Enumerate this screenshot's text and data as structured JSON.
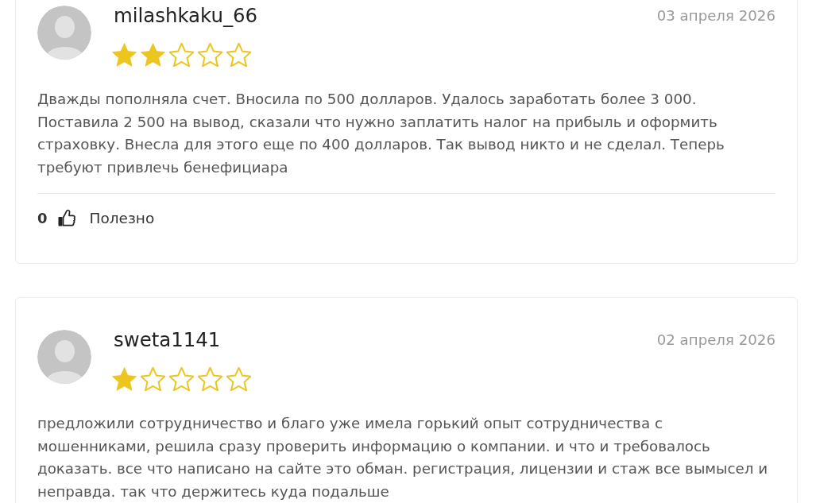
{
  "reviews": [
    {
      "username": "milashkaku_66",
      "date": "03 апреля 2026",
      "stars": 2,
      "text": "Дважды пополняла счет. Вносила по 500 долларов. Удалось заработать более 3 000. Поставила 2 500 на вывод, сказали что нужно заплатить налог на прибыль и оформить страховку. Внесла для этого еще по 400 долларов. Так вывод никто и не сделал. Теперь требуют привлечь бенефициара",
      "footer": {
        "likes": "0",
        "helpful_label": "Полезно"
      }
    },
    {
      "username": "sweta1141",
      "date": "02 апреля 2026",
      "stars": 1,
      "text": "предложили сотрудничество и благо уже имела горький опыт сотрудничества с мошенниками, решила сразу проверить информацию о компании. и что и требовалось доказать. все что написано на сайте это обман. регистрация, лицензии и стаж все вымысел и неправда. так что держитесь куда подальше"
    }
  ]
}
